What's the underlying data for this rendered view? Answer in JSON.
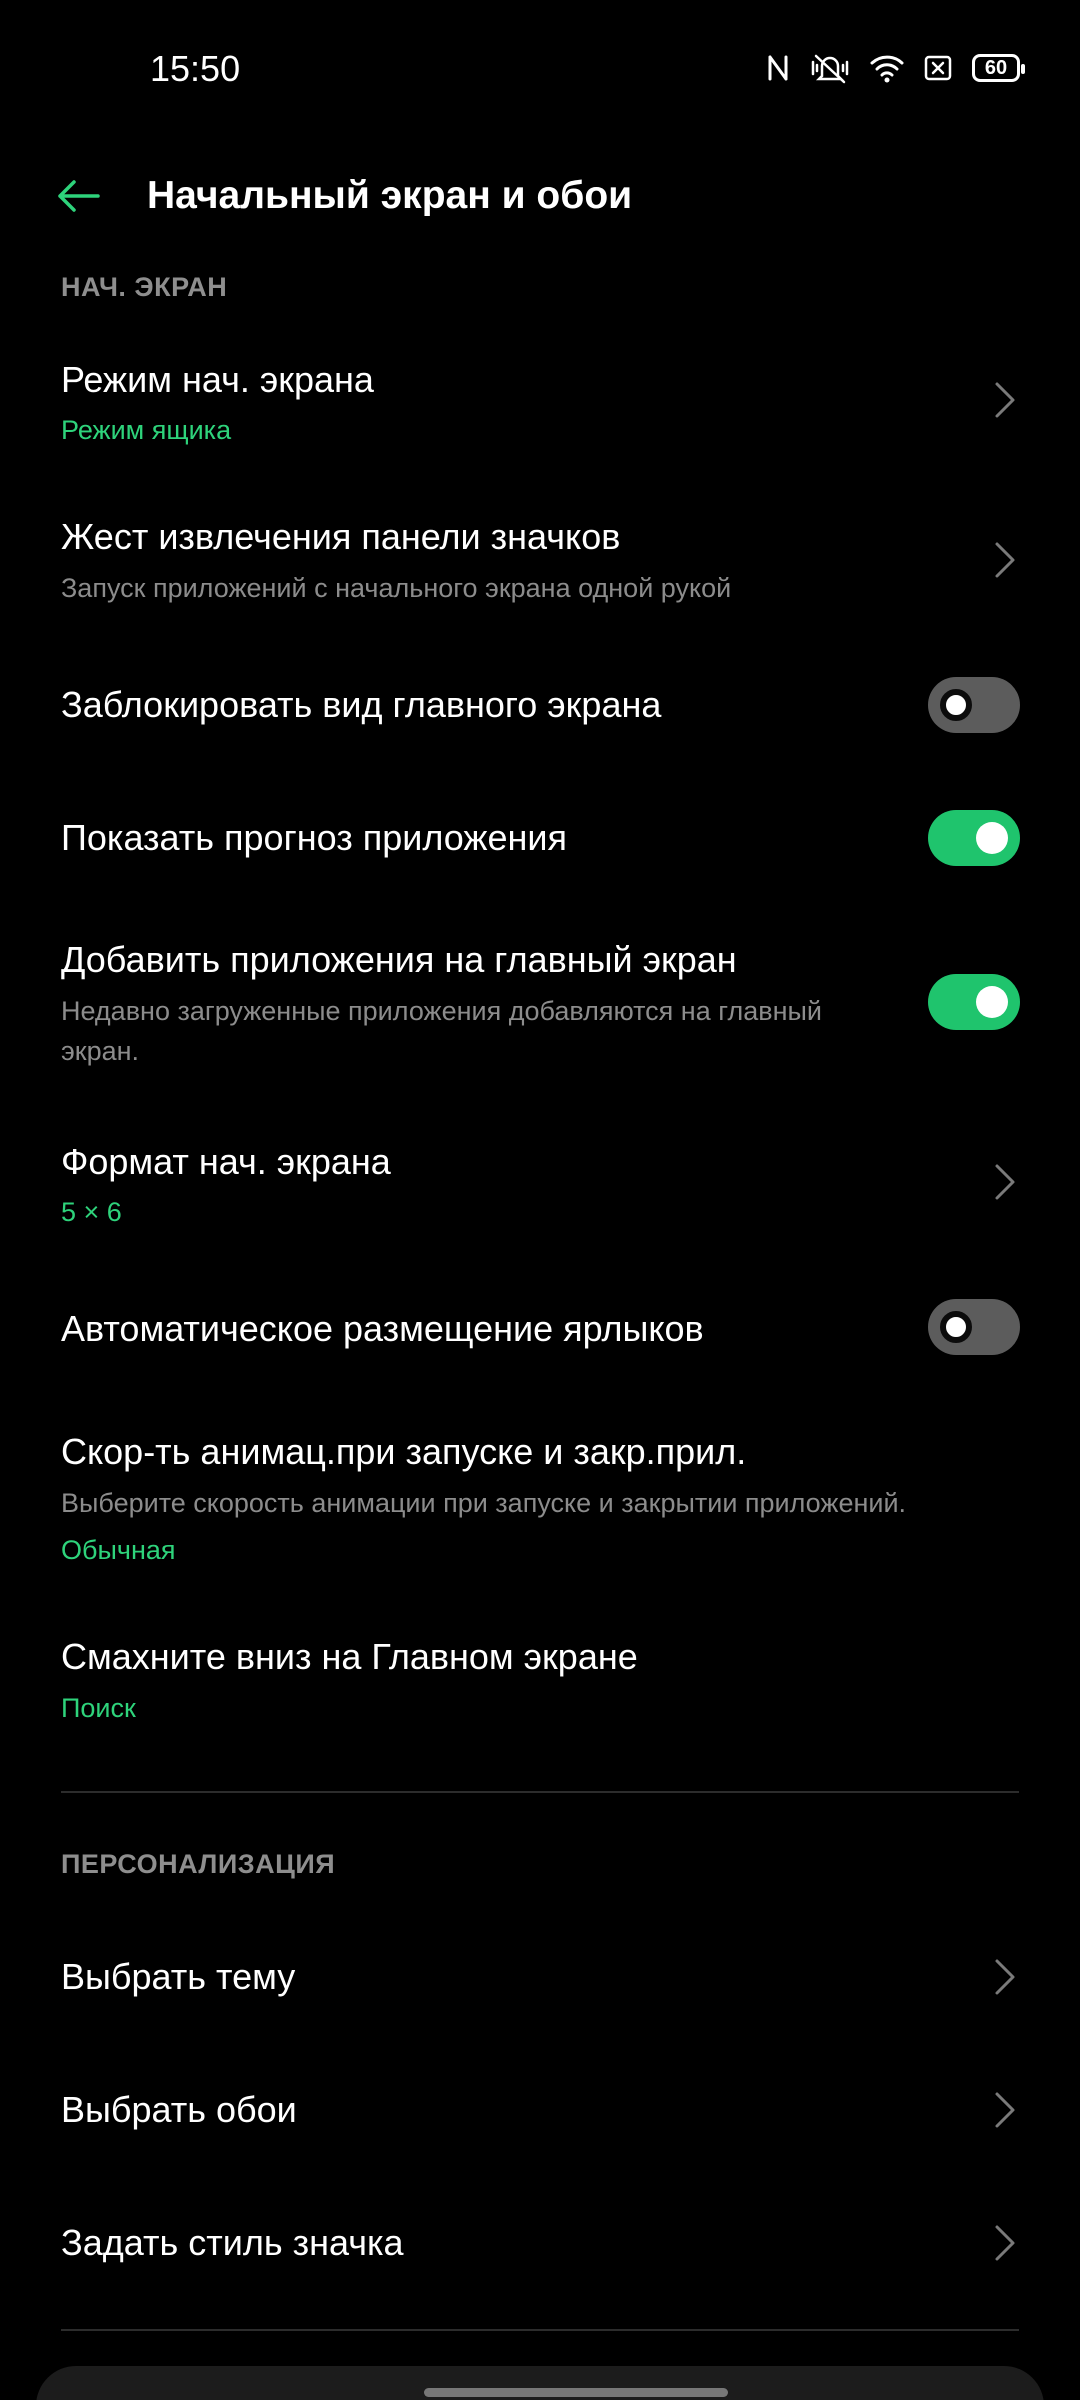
{
  "status": {
    "time": "15:50",
    "battery": "60"
  },
  "header": {
    "title": "Начальный экран и обои"
  },
  "sections": {
    "home": "НАЧ. ЭКРАН",
    "personal": "ПЕРСОНАЛИЗАЦИЯ"
  },
  "rows": {
    "mode": {
      "title": "Режим нач. экрана",
      "value": "Режим ящика"
    },
    "gesture": {
      "title": "Жест извлечения панели значков",
      "sub": "Запуск приложений с начального экрана одной рукой"
    },
    "lock": {
      "title": "Заблокировать вид главного экрана",
      "toggle": false
    },
    "predict": {
      "title": "Показать прогноз приложения",
      "toggle": true
    },
    "add": {
      "title": "Добавить приложения на главный экран",
      "sub": "Недавно загруженные приложения добавляются на главный экран.",
      "toggle": true
    },
    "format": {
      "title": "Формат нач. экрана",
      "value": "5 × 6"
    },
    "auto": {
      "title": "Автоматическое размещение ярлыков",
      "toggle": false
    },
    "anim": {
      "title": "Скор-ть анимац.при запуске и закр.прил.",
      "sub": "Выберите скорость анимации при запуске и закрытии приложений.",
      "value": "Обычная"
    },
    "swipe": {
      "title": "Смахните вниз на Главном экране",
      "value": "Поиск"
    },
    "theme": {
      "title": "Выбрать тему"
    },
    "wallpaper": {
      "title": "Выбрать обои"
    },
    "iconstyle": {
      "title": "Задать стиль значка"
    }
  },
  "colors": {
    "accent": "#2ed37b",
    "toggle_on": "#1fc46d",
    "toggle_off": "#5c5c5c",
    "background": "#000000"
  }
}
